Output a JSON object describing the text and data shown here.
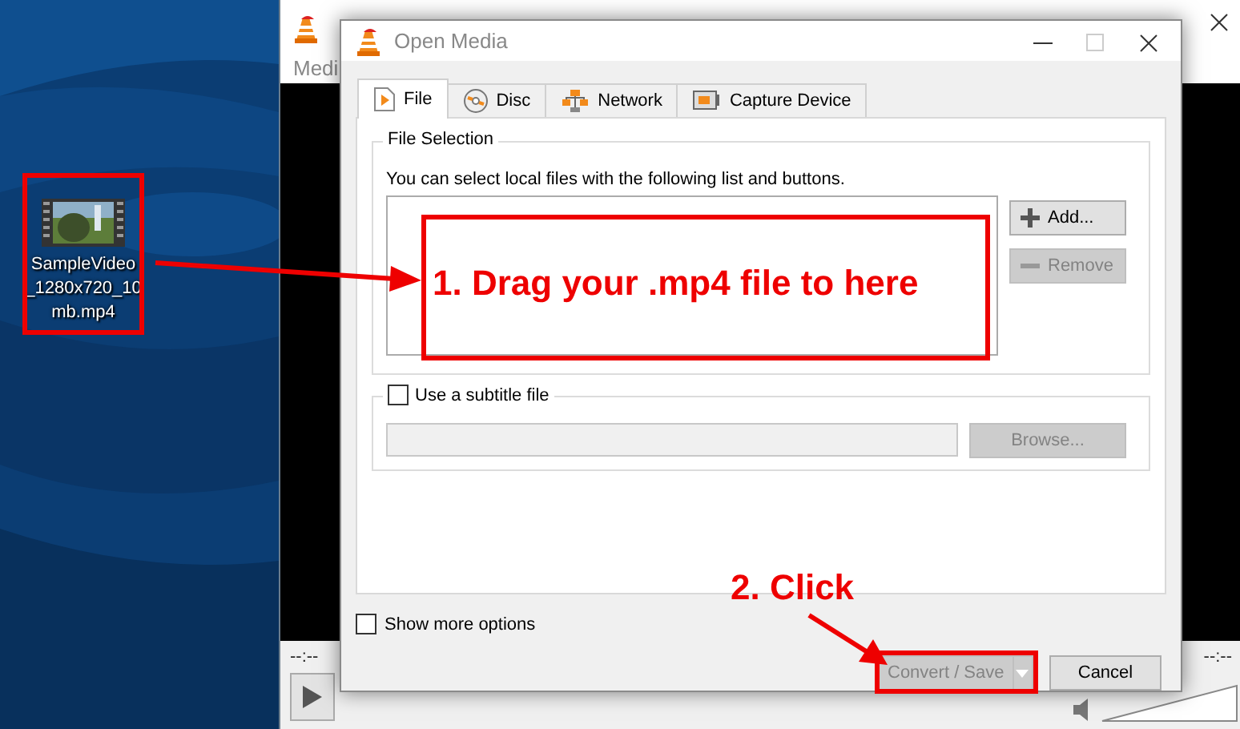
{
  "desktop_icon": {
    "label_lines": [
      "SampleVideo",
      "_1280x720_10",
      "mb.mp4"
    ],
    "selected": false
  },
  "background_window": {
    "menu": "Medi",
    "time_elapsed": "--:--",
    "time_total": "--:--",
    "volume": {
      "level": 0.0
    }
  },
  "dialog": {
    "title": "Open Media",
    "tabs": [
      {
        "label": "File",
        "selected": true
      },
      {
        "label": "Disc",
        "selected": false
      },
      {
        "label": "Network",
        "selected": false
      },
      {
        "label": "Capture Device",
        "selected": false
      }
    ],
    "file_selection": {
      "title": "File Selection",
      "hint": "You can select local files with the following list and buttons.",
      "buttons": [
        {
          "label": "Add...",
          "disabled": false
        },
        {
          "label": "Remove",
          "disabled": true
        }
      ]
    },
    "subtitle": {
      "label": "Use a subtitle file",
      "checked": false,
      "browse": {
        "label": "Browse...",
        "disabled": true
      }
    },
    "show_more_options": {
      "label": "Show more options",
      "checked": false
    },
    "buttons": [
      {
        "label": "Convert / Save",
        "disabled": true,
        "kind": "split"
      },
      {
        "label": "Cancel",
        "disabled": false,
        "kind": "plain"
      }
    ]
  },
  "annotations": [
    {
      "text": "1. Drag your .mp4 file to here"
    },
    {
      "text": "2. Click"
    }
  ]
}
